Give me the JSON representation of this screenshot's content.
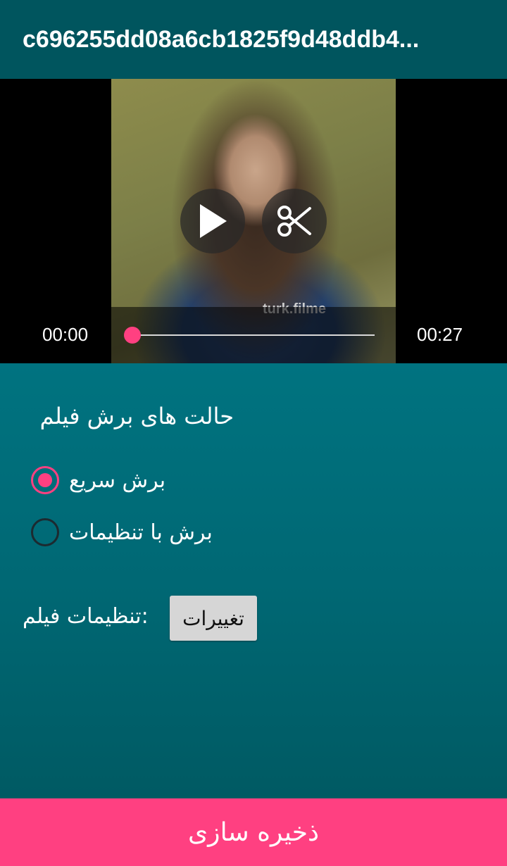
{
  "appbar": {
    "title": "c696255dd08a6cb1825f9d48ddb4..."
  },
  "player": {
    "watermark": "turk.filme",
    "current_time": "00:00",
    "total_time": "00:27",
    "progress": 0,
    "play_icon": "play-icon",
    "cut_icon": "scissors-icon"
  },
  "trim_modes": {
    "title": "حالت های برش فیلم",
    "options": [
      {
        "label": "برش سریع",
        "checked": true
      },
      {
        "label": "برش با تنظیمات",
        "checked": false
      }
    ]
  },
  "settings": {
    "label": ":تنظیمات فیلم",
    "button_label": "تغییرات"
  },
  "save": {
    "label": "ذخیره سازی"
  },
  "colors": {
    "accent": "#ff4081",
    "appbar": "#00555e",
    "background": "#00606c"
  }
}
